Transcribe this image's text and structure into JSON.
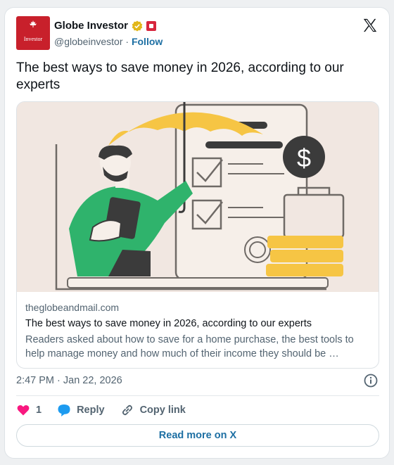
{
  "account": {
    "name": "Globe Investor",
    "handle": "@globeinvestor",
    "separator": "·",
    "follow_label": "Follow",
    "avatar_text": "Investor"
  },
  "tweet": {
    "text": "The best ways to save money in 2026, according to our experts"
  },
  "link_card": {
    "domain": "theglobeandmail.com",
    "title": "The best ways to save money in 2026, according to our experts",
    "description": "Readers asked about how to save for a home purchase, the best tools to help manage money and how much of their income they should be …"
  },
  "timestamp": "2:47 PM · Jan 22, 2026",
  "actions": {
    "like_count": "1",
    "reply_label": "Reply",
    "copy_label": "Copy link"
  },
  "read_more_label": "Read more on X",
  "icons": {
    "verified": "gold-verified-badge-icon",
    "affiliate": "affiliate-flag-icon",
    "brand": "x-logo-icon",
    "info": "info-icon",
    "like": "heart-icon",
    "reply": "speech-bubble-icon",
    "copy": "link-icon"
  },
  "colors": {
    "brand_red": "#c8202b",
    "link_blue": "#1d6fa3",
    "heart": "#f91880",
    "reply_bubble": "#1d9bf0",
    "umbrella": "#f6c544",
    "shirt": "#2fb36c"
  }
}
